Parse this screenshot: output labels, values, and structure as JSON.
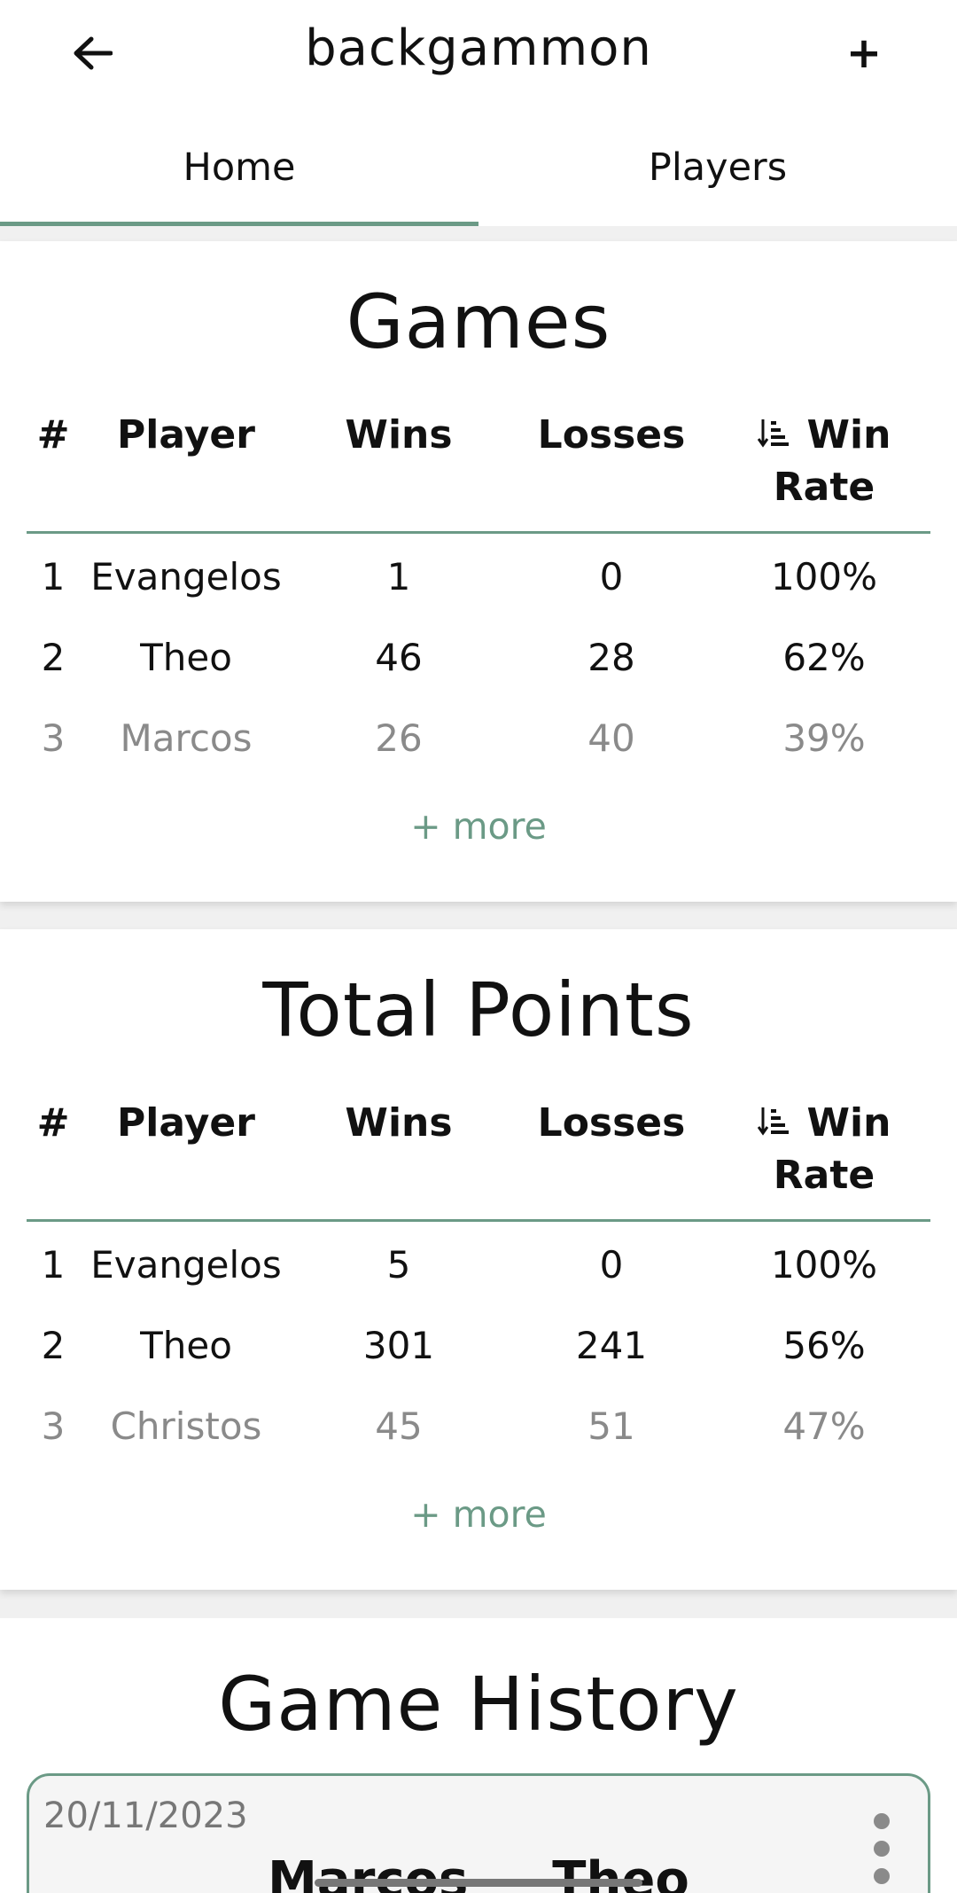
{
  "appbar": {
    "title": "backgammon",
    "back_icon": "arrow-left-icon",
    "add_label": "+"
  },
  "tabs": [
    {
      "label": "Home",
      "active": true
    },
    {
      "label": "Players",
      "active": false
    }
  ],
  "colors": {
    "accent": "#6b9a86",
    "faded_text": "#8a8a8a"
  },
  "games": {
    "title": "Games",
    "headers": {
      "rank": "#",
      "player": "Player",
      "wins": "Wins",
      "losses": "Losses",
      "win_rate_1": "Win",
      "win_rate_2": "Rate",
      "sort_icon": "sort-descending-icon"
    },
    "rows": [
      {
        "rank": "1",
        "player": "Evangelos",
        "wins": "1",
        "losses": "0",
        "rate": "100%"
      },
      {
        "rank": "2",
        "player": "Theo",
        "wins": "46",
        "losses": "28",
        "rate": "62%"
      },
      {
        "rank": "3",
        "player": "Marcos",
        "wins": "26",
        "losses": "40",
        "rate": "39%"
      }
    ],
    "more": "+ more"
  },
  "points": {
    "title": "Total Points",
    "headers": {
      "rank": "#",
      "player": "Player",
      "wins": "Wins",
      "losses": "Losses",
      "win_rate_1": "Win",
      "win_rate_2": "Rate",
      "sort_icon": "sort-descending-icon"
    },
    "rows": [
      {
        "rank": "1",
        "player": "Evangelos",
        "wins": "5",
        "losses": "0",
        "rate": "100%"
      },
      {
        "rank": "2",
        "player": "Theo",
        "wins": "301",
        "losses": "241",
        "rate": "56%"
      },
      {
        "rank": "3",
        "player": "Christos",
        "wins": "45",
        "losses": "51",
        "rate": "47%"
      }
    ],
    "more": "+ more"
  },
  "history": {
    "title": "Game History",
    "cards": [
      {
        "date": "20/11/2023",
        "players": "Marcos — Theo"
      }
    ]
  }
}
